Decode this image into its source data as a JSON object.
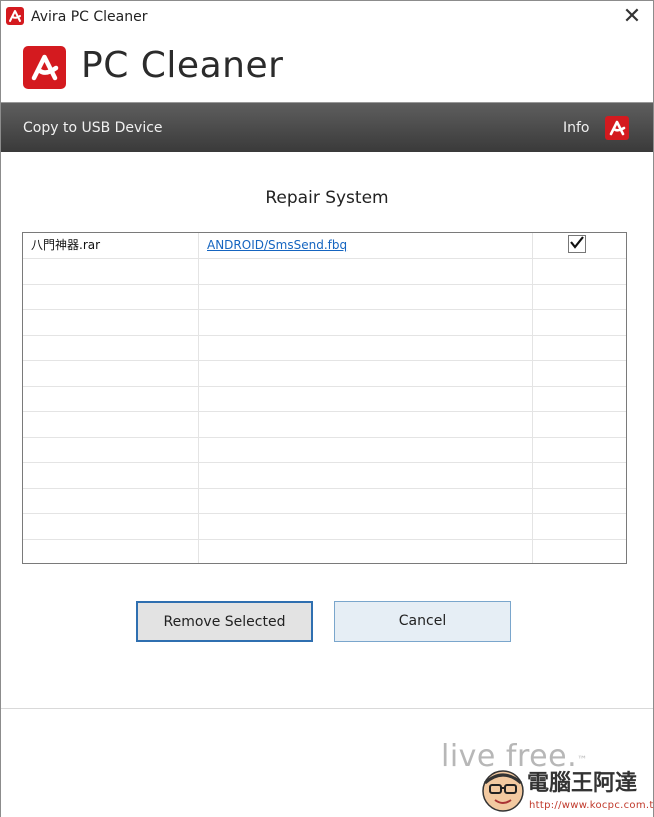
{
  "window": {
    "title": "Avira PC Cleaner",
    "close_glyph": "✕"
  },
  "brand": {
    "product_name": "PC Cleaner",
    "logo_icon": "avira-umbrella-icon",
    "accent_color": "#d41a1f"
  },
  "toolbar": {
    "copy_usb_label": "Copy to USB Device",
    "info_label": "Info"
  },
  "main": {
    "heading": "Repair System",
    "rows": [
      {
        "name": "八門神器.rar",
        "path": "ANDROID/SmsSend.fbq",
        "checked": true
      },
      {
        "name": "",
        "path": "",
        "checked": false
      },
      {
        "name": "",
        "path": "",
        "checked": false
      },
      {
        "name": "",
        "path": "",
        "checked": false
      },
      {
        "name": "",
        "path": "",
        "checked": false
      },
      {
        "name": "",
        "path": "",
        "checked": false
      },
      {
        "name": "",
        "path": "",
        "checked": false
      },
      {
        "name": "",
        "path": "",
        "checked": false
      },
      {
        "name": "",
        "path": "",
        "checked": false
      },
      {
        "name": "",
        "path": "",
        "checked": false
      },
      {
        "name": "",
        "path": "",
        "checked": false
      },
      {
        "name": "",
        "path": "",
        "checked": false
      },
      {
        "name": "",
        "path": "",
        "checked": false
      }
    ]
  },
  "buttons": {
    "remove_label": "Remove Selected",
    "cancel_label": "Cancel"
  },
  "footer": {
    "tagline": "live free.",
    "tagline_mark": "™",
    "watermark_text": "電腦王阿達",
    "watermark_url": "http://www.kocpc.com.tw"
  }
}
